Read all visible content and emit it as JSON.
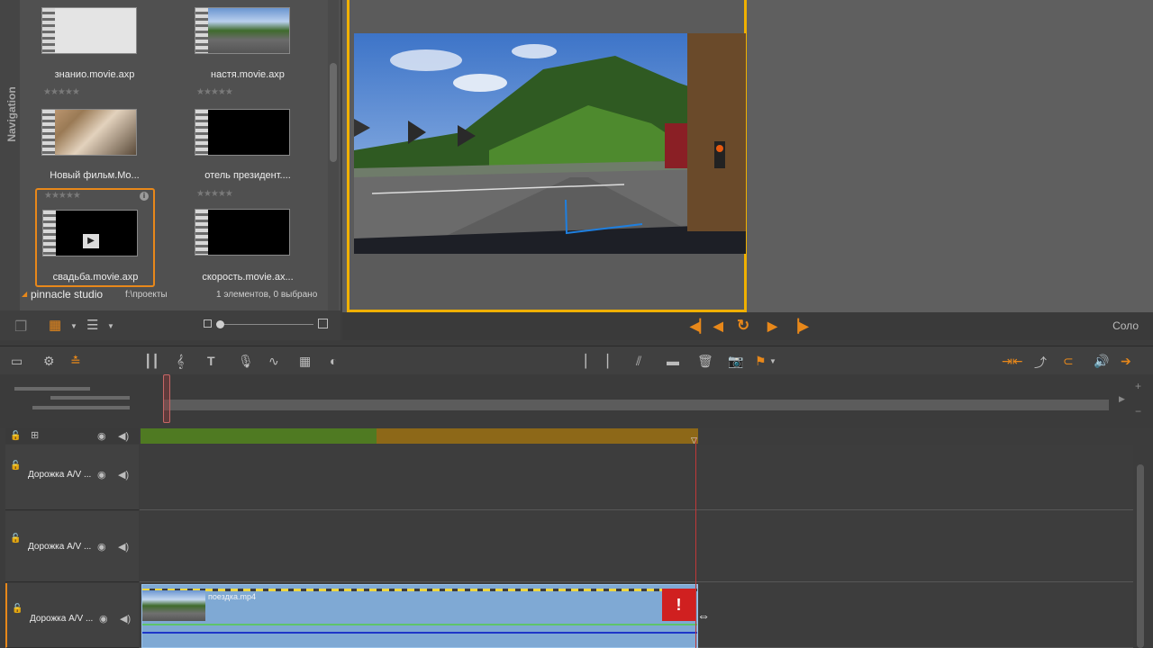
{
  "library": {
    "nav_label": "Navigation",
    "assets": [
      {
        "name": "знанио.movie.axp"
      },
      {
        "name": "настя.movie.axp"
      },
      {
        "name": "Новый фильм.Mo..."
      },
      {
        "name": "отель президент...."
      },
      {
        "name": "свадьба.movie.axp"
      },
      {
        "name": "скорость.movie.ax..."
      }
    ],
    "stars": "★★★★★",
    "footer": {
      "root": "pinnacle studio",
      "path": "f:\\проекты",
      "count": "1 элементов, 0 выбрано"
    }
  },
  "player": {
    "solo_label": "Соло"
  },
  "timeline": {
    "tracks": [
      {
        "label": "Дорожка A/V ..."
      },
      {
        "label": "Дорожка A/V ..."
      },
      {
        "label": "Дорожка A/V ..."
      }
    ],
    "clip": {
      "name": "поездка.mp4"
    }
  }
}
